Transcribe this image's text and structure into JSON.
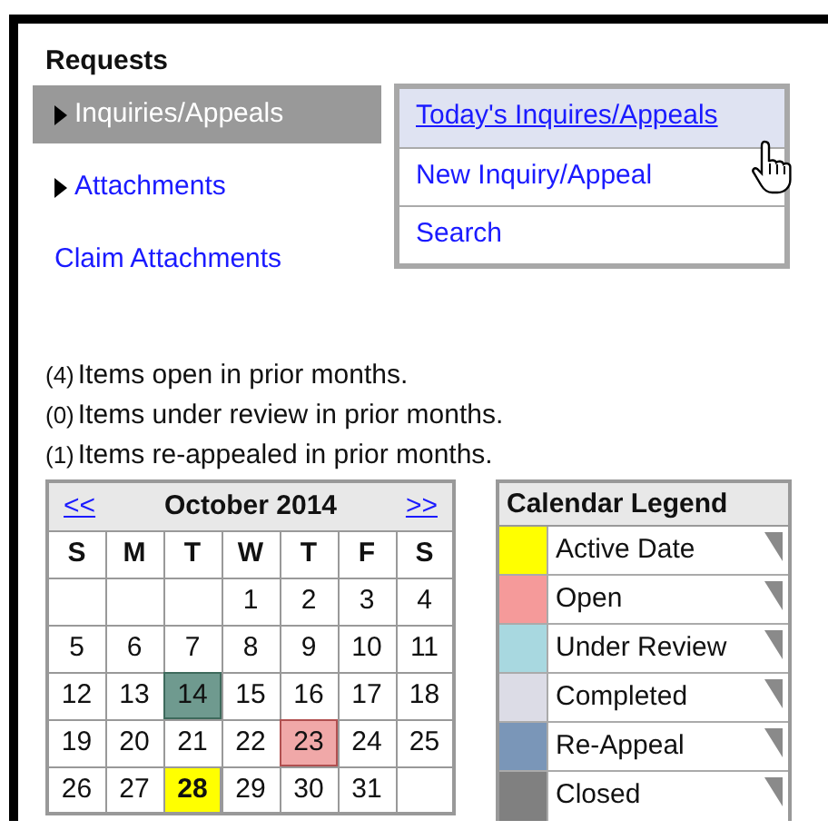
{
  "title": "Requests",
  "menu": [
    {
      "label": "Inquiries/Appeals",
      "kind": "submenu",
      "selected": true
    },
    {
      "label": "Attachments",
      "kind": "submenu",
      "selected": false
    },
    {
      "label": "Claim Attachments",
      "kind": "link",
      "selected": false
    }
  ],
  "flyout": [
    {
      "label": "Today's Inquires/Appeals",
      "hovered": true
    },
    {
      "label": "New Inquiry/Appeal",
      "hovered": false
    },
    {
      "label": "Search",
      "hovered": false
    }
  ],
  "prior_counts": [
    {
      "count": "(4)",
      "text": "Items open in prior months."
    },
    {
      "count": "(0)",
      "text": "Items under review in prior months."
    },
    {
      "count": "(1)",
      "text": "Items re-appealed in prior months."
    }
  ],
  "calendar": {
    "prev": "<<",
    "month": "October 2014",
    "next": ">>",
    "weekdays": [
      "S",
      "M",
      "T",
      "W",
      "T",
      "F",
      "S"
    ],
    "weeks": [
      [
        {
          "kind": "blank"
        },
        {
          "kind": "blank"
        },
        {
          "kind": "blank"
        },
        {
          "day": "1",
          "kind": "plain"
        },
        {
          "day": "2",
          "kind": "plain"
        },
        {
          "day": "3",
          "kind": "plain"
        },
        {
          "day": "4",
          "kind": "plain"
        }
      ],
      [
        {
          "day": "5",
          "kind": "plain"
        },
        {
          "day": "6",
          "kind": "plain"
        },
        {
          "day": "7",
          "kind": "plain"
        },
        {
          "day": "8",
          "kind": "plain"
        },
        {
          "day": "9",
          "kind": "plain"
        },
        {
          "day": "10",
          "kind": "plain"
        },
        {
          "day": "11",
          "kind": "plain"
        }
      ],
      [
        {
          "day": "12",
          "kind": "plain"
        },
        {
          "day": "13",
          "kind": "plain"
        },
        {
          "day": "14",
          "kind": "today"
        },
        {
          "day": "15",
          "kind": "plain"
        },
        {
          "day": "16",
          "kind": "plain"
        },
        {
          "day": "17",
          "kind": "plain"
        },
        {
          "day": "18",
          "kind": "plain"
        }
      ],
      [
        {
          "day": "19",
          "kind": "plain"
        },
        {
          "day": "20",
          "kind": "plain"
        },
        {
          "day": "21",
          "kind": "plain"
        },
        {
          "day": "22",
          "kind": "plain"
        },
        {
          "day": "23",
          "kind": "open"
        },
        {
          "day": "24",
          "kind": "plain"
        },
        {
          "day": "25",
          "kind": "plain"
        }
      ],
      [
        {
          "day": "26",
          "kind": "plain"
        },
        {
          "day": "27",
          "kind": "plain"
        },
        {
          "day": "28",
          "kind": "active"
        },
        {
          "day": "29",
          "kind": "plain"
        },
        {
          "day": "30",
          "kind": "plain"
        },
        {
          "day": "31",
          "kind": "plain"
        },
        {
          "kind": "blank"
        }
      ]
    ]
  },
  "legend": {
    "title": "Calendar Legend",
    "items": [
      {
        "label": "Active Date",
        "color": "#ffff00"
      },
      {
        "label": "Open",
        "color": "#f59a9a"
      },
      {
        "label": "Under Review",
        "color": "#a8d8e0"
      },
      {
        "label": "Completed",
        "color": "#dcdce6"
      },
      {
        "label": "Re-Appeal",
        "color": "#7a96b8"
      },
      {
        "label": "Closed",
        "color": "#808080"
      }
    ]
  }
}
